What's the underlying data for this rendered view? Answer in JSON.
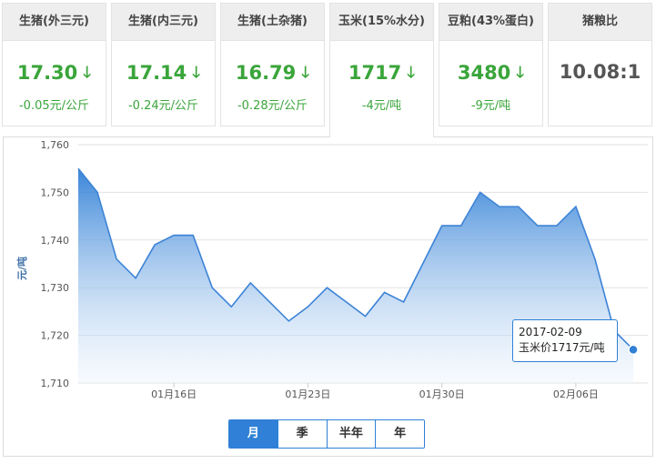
{
  "cards": [
    {
      "title": "生猪(外三元)",
      "price": "17.30",
      "delta": "-0.05元/公斤",
      "trend": "down"
    },
    {
      "title": "生猪(内三元)",
      "price": "17.14",
      "delta": "-0.24元/公斤",
      "trend": "down"
    },
    {
      "title": "生猪(土杂猪)",
      "price": "16.79",
      "delta": "-0.28元/公斤",
      "trend": "down"
    },
    {
      "title": "玉米(15%水分)",
      "price": "1717",
      "delta": "-4元/吨",
      "trend": "down"
    },
    {
      "title": "豆粕(43%蛋白)",
      "price": "3480",
      "delta": "-9元/吨",
      "trend": "down"
    },
    {
      "title": "猪粮比",
      "price": "10.08:1",
      "delta": "",
      "trend": "none"
    }
  ],
  "active_card": 3,
  "tooltip": {
    "date": "2017-02-09",
    "text": "玉米价1717元/吨"
  },
  "period_tabs": [
    "月",
    "季",
    "半年",
    "年"
  ],
  "active_period": 0,
  "colors": {
    "accent": "#2f80d6",
    "down": "#3aa53a",
    "line": "#3d83d6"
  },
  "chart_data": {
    "type": "area",
    "ylabel": "元/吨",
    "ylim": [
      1710,
      1760
    ],
    "yticks": [
      1710,
      1720,
      1730,
      1740,
      1750,
      1760
    ],
    "ytick_labels": [
      "1,710",
      "1,720",
      "1,730",
      "1,740",
      "1,750",
      "1,760"
    ],
    "x": [
      "2017-01-11",
      "2017-01-12",
      "2017-01-13",
      "2017-01-14",
      "2017-01-15",
      "2017-01-16",
      "2017-01-17",
      "2017-01-18",
      "2017-01-19",
      "2017-01-20",
      "2017-01-21",
      "2017-01-22",
      "2017-01-23",
      "2017-01-24",
      "2017-01-25",
      "2017-01-26",
      "2017-01-27",
      "2017-01-28",
      "2017-01-29",
      "2017-01-30",
      "2017-01-31",
      "2017-02-01",
      "2017-02-02",
      "2017-02-03",
      "2017-02-04",
      "2017-02-05",
      "2017-02-06",
      "2017-02-07",
      "2017-02-08",
      "2017-02-09"
    ],
    "values": [
      1755,
      1750,
      1736,
      1732,
      1739,
      1741,
      1741,
      1730,
      1726,
      1731,
      1727,
      1723,
      1726,
      1730,
      1727,
      1724,
      1729,
      1727,
      1735,
      1743,
      1743,
      1750,
      1747,
      1747,
      1743,
      1743,
      1747,
      1736,
      1721,
      1717
    ],
    "xticks": [
      {
        "date": "2017-01-16",
        "label": "01月16日"
      },
      {
        "date": "2017-01-23",
        "label": "01月23日"
      },
      {
        "date": "2017-01-30",
        "label": "01月30日"
      },
      {
        "date": "2017-02-06",
        "label": "02月06日"
      }
    ],
    "grid": true,
    "legend": "none"
  }
}
